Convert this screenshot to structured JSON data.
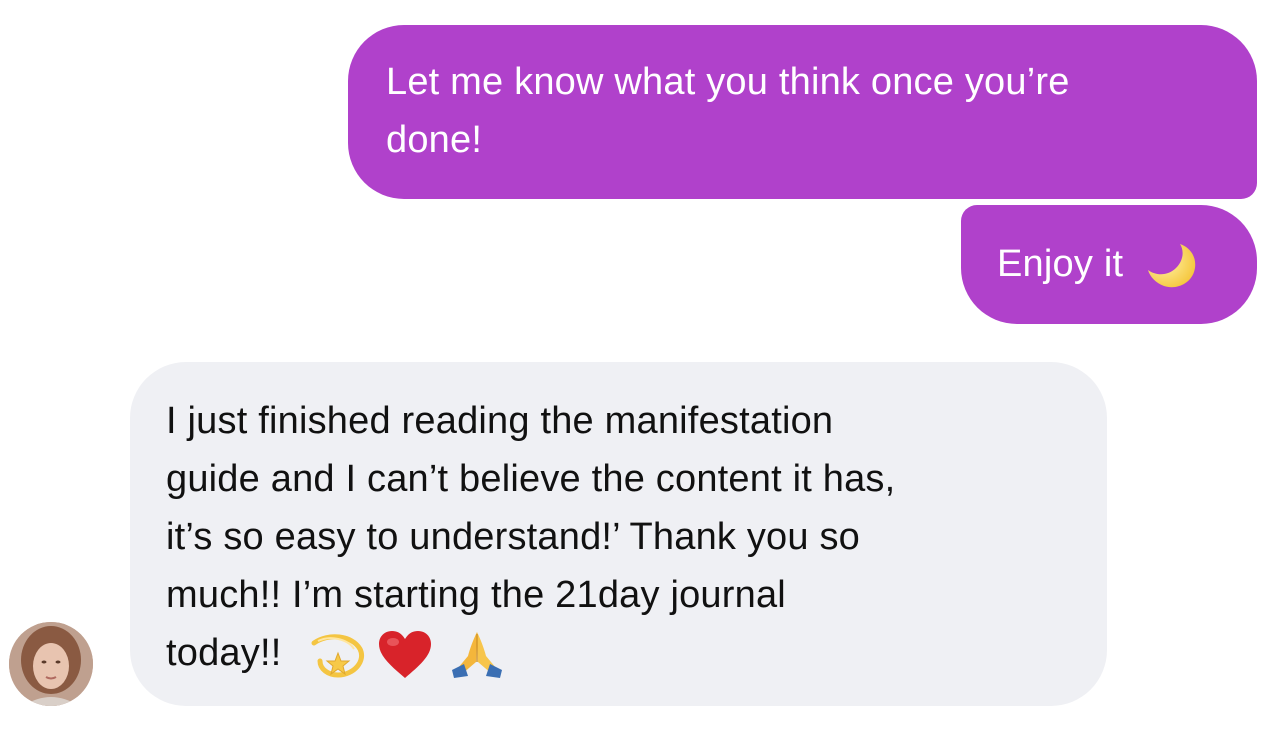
{
  "colors": {
    "outgoing_bubble": "#b041cb",
    "incoming_bubble": "#eff0f4",
    "background": "#ffffff"
  },
  "messages": [
    {
      "direction": "outgoing",
      "text": "Let me know what you think once you’re\ndone!"
    },
    {
      "direction": "outgoing",
      "text": "Enjoy it",
      "emoji": [
        "crescent-moon"
      ]
    },
    {
      "direction": "incoming",
      "text": "I just finished reading the manifestation\nguide and I can’t believe the content it has,\nit’s so easy to understand!’ Thank you so\nmuch!! I’m starting the 21day journal\ntoday!!",
      "emoji": [
        "dizzy-star",
        "red-heart",
        "praying-hands"
      ]
    }
  ],
  "sender": {
    "avatar_icon": "avatar-photo"
  }
}
